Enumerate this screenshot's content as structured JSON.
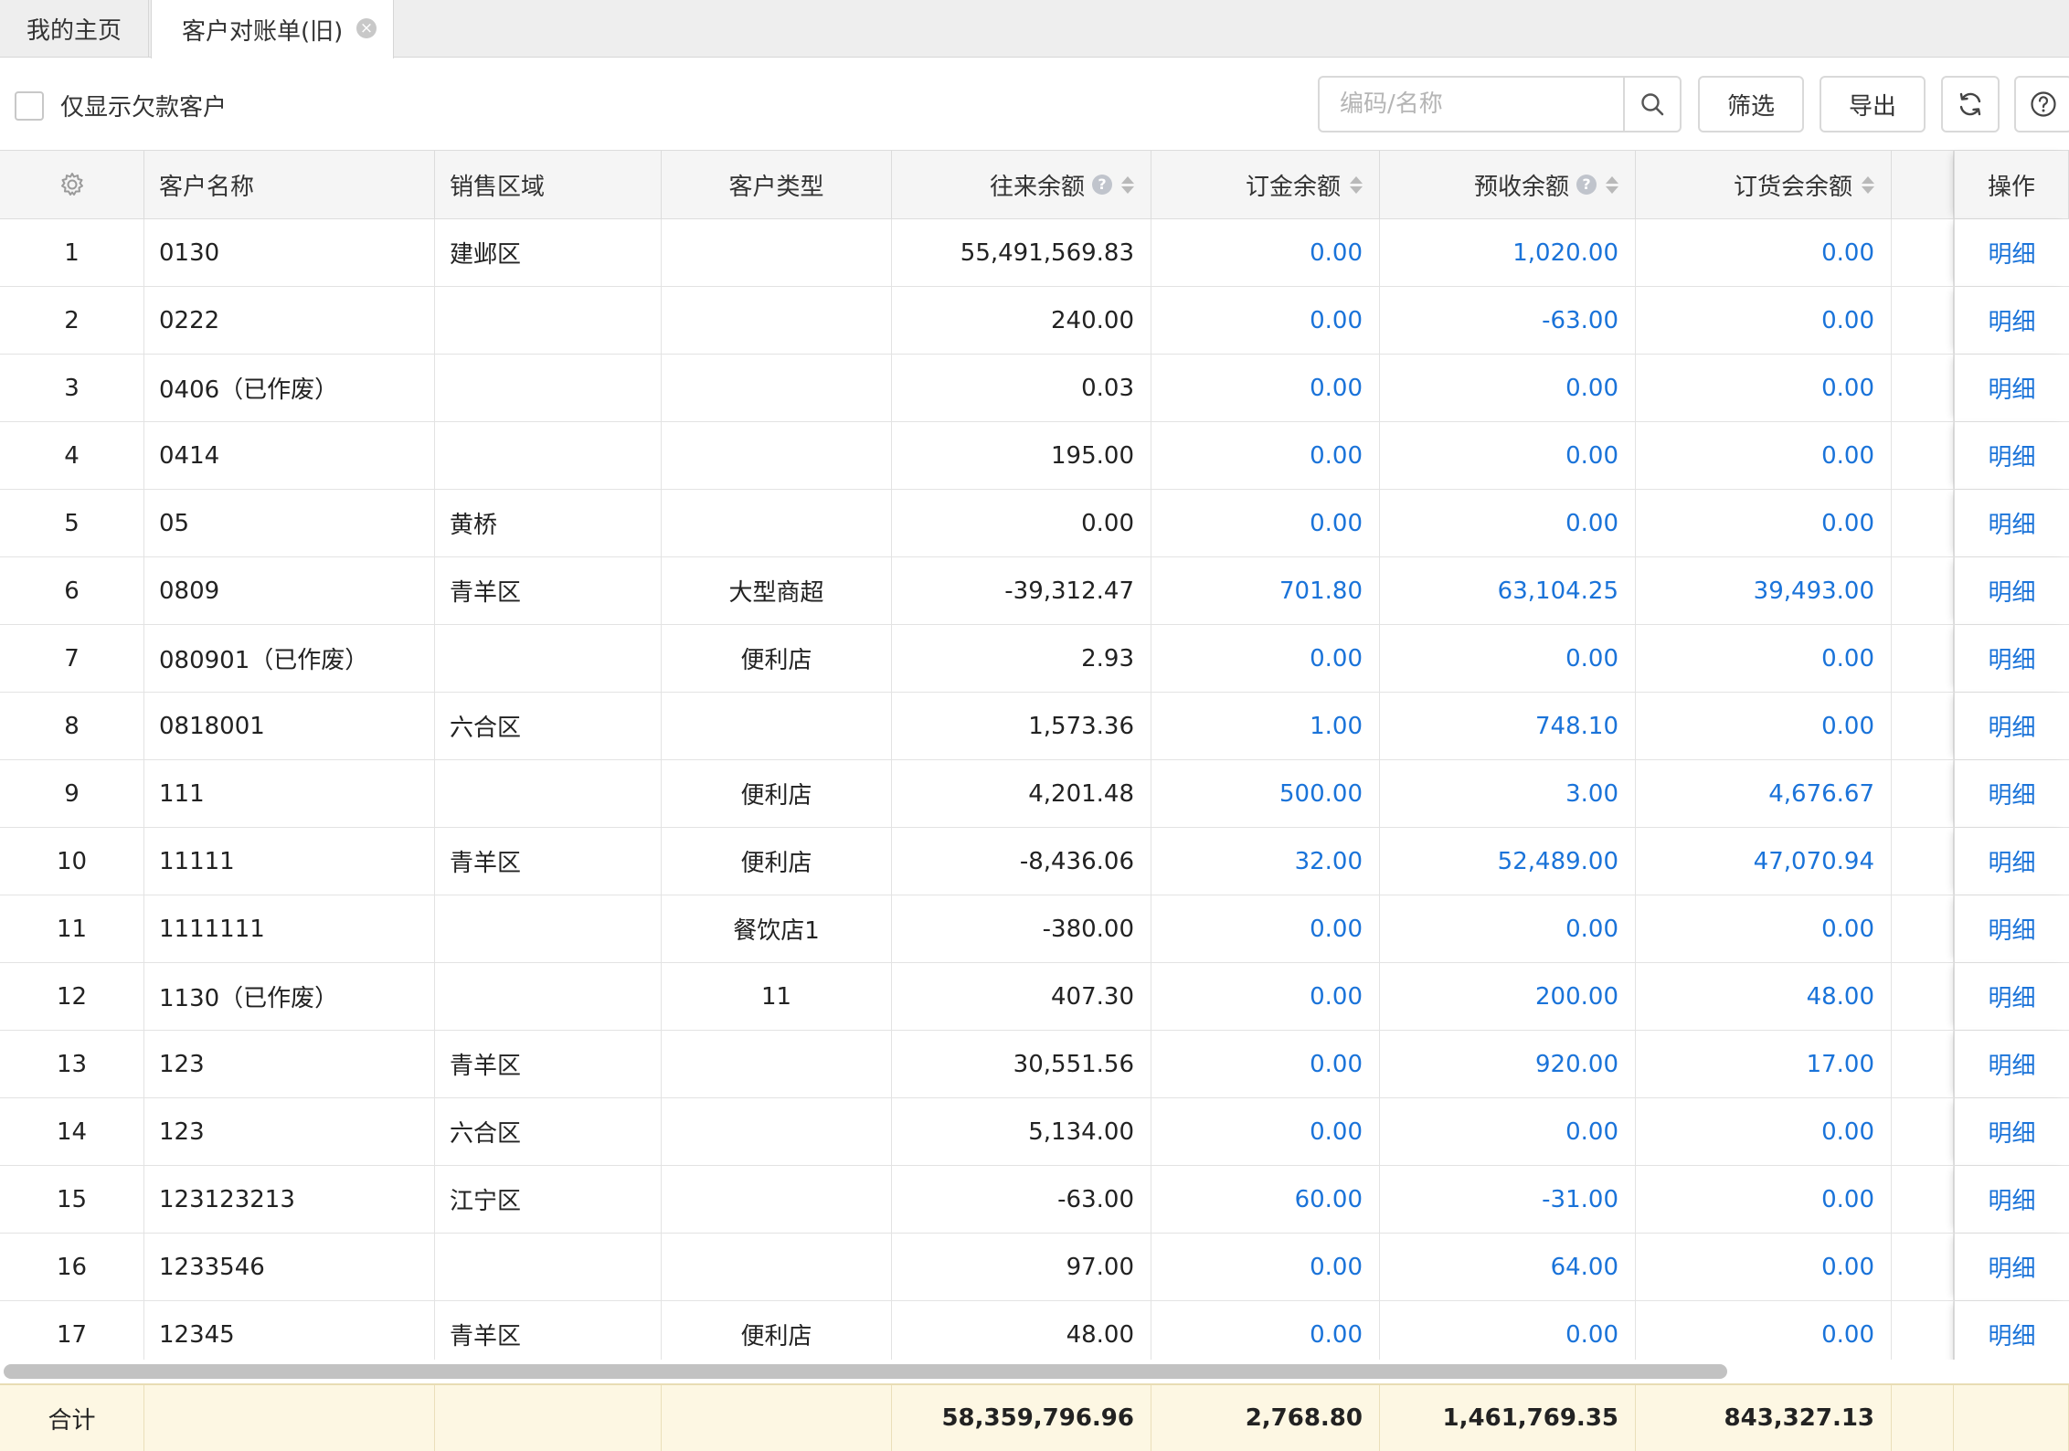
{
  "tabs": {
    "home": "我的主页",
    "active": "客户对账单(旧)",
    "close_glyph": "×"
  },
  "toolbar": {
    "only_debt_label": "仅显示欠款客户",
    "search_placeholder": "编码/名称",
    "filter_label": "筛选",
    "export_label": "导出"
  },
  "columns": {
    "name": "客户名称",
    "region": "销售区域",
    "type": "客户类型",
    "balance": "往来余额",
    "deposit": "订金余额",
    "prepaid": "预收余额",
    "order_meeting": "订货会余额",
    "operation": "操作"
  },
  "help_glyph": "?",
  "detail_label": "明细",
  "rows": [
    {
      "idx": "1",
      "name": "0130",
      "region": "建邺区",
      "type": "",
      "balance": "55,491,569.83",
      "deposit": "0.00",
      "prepaid": "1,020.00",
      "order_meeting": "0.00"
    },
    {
      "idx": "2",
      "name": "0222",
      "region": "",
      "type": "",
      "balance": "240.00",
      "deposit": "0.00",
      "prepaid": "-63.00",
      "order_meeting": "0.00"
    },
    {
      "idx": "3",
      "name": "0406（已作废）",
      "region": "",
      "type": "",
      "balance": "0.03",
      "deposit": "0.00",
      "prepaid": "0.00",
      "order_meeting": "0.00"
    },
    {
      "idx": "4",
      "name": "0414",
      "region": "",
      "type": "",
      "balance": "195.00",
      "deposit": "0.00",
      "prepaid": "0.00",
      "order_meeting": "0.00"
    },
    {
      "idx": "5",
      "name": "05",
      "region": "黄桥",
      "type": "",
      "balance": "0.00",
      "deposit": "0.00",
      "prepaid": "0.00",
      "order_meeting": "0.00"
    },
    {
      "idx": "6",
      "name": "0809",
      "region": "青羊区",
      "type": "大型商超",
      "balance": "-39,312.47",
      "deposit": "701.80",
      "prepaid": "63,104.25",
      "order_meeting": "39,493.00"
    },
    {
      "idx": "7",
      "name": "080901（已作废）",
      "region": "",
      "type": "便利店",
      "balance": "2.93",
      "deposit": "0.00",
      "prepaid": "0.00",
      "order_meeting": "0.00"
    },
    {
      "idx": "8",
      "name": "0818001",
      "region": "六合区",
      "type": "",
      "balance": "1,573.36",
      "deposit": "1.00",
      "prepaid": "748.10",
      "order_meeting": "0.00"
    },
    {
      "idx": "9",
      "name": "111",
      "region": "",
      "type": "便利店",
      "balance": "4,201.48",
      "deposit": "500.00",
      "prepaid": "3.00",
      "order_meeting": "4,676.67"
    },
    {
      "idx": "10",
      "name": "11111",
      "region": "青羊区",
      "type": "便利店",
      "balance": "-8,436.06",
      "deposit": "32.00",
      "prepaid": "52,489.00",
      "order_meeting": "47,070.94"
    },
    {
      "idx": "11",
      "name": "1111111",
      "region": "",
      "type": "餐饮店1",
      "balance": "-380.00",
      "deposit": "0.00",
      "prepaid": "0.00",
      "order_meeting": "0.00"
    },
    {
      "idx": "12",
      "name": "1130（已作废）",
      "region": "",
      "type": "11",
      "balance": "407.30",
      "deposit": "0.00",
      "prepaid": "200.00",
      "order_meeting": "48.00"
    },
    {
      "idx": "13",
      "name": "123",
      "region": "青羊区",
      "type": "",
      "balance": "30,551.56",
      "deposit": "0.00",
      "prepaid": "920.00",
      "order_meeting": "17.00"
    },
    {
      "idx": "14",
      "name": "123",
      "region": "六合区",
      "type": "",
      "balance": "5,134.00",
      "deposit": "0.00",
      "prepaid": "0.00",
      "order_meeting": "0.00"
    },
    {
      "idx": "15",
      "name": "123123213",
      "region": "江宁区",
      "type": "",
      "balance": "-63.00",
      "deposit": "60.00",
      "prepaid": "-31.00",
      "order_meeting": "0.00"
    },
    {
      "idx": "16",
      "name": "1233546",
      "region": "",
      "type": "",
      "balance": "97.00",
      "deposit": "0.00",
      "prepaid": "64.00",
      "order_meeting": "0.00"
    },
    {
      "idx": "17",
      "name": "12345",
      "region": "青羊区",
      "type": "便利店",
      "balance": "48.00",
      "deposit": "0.00",
      "prepaid": "0.00",
      "order_meeting": "0.00"
    }
  ],
  "totals": {
    "label": "合计",
    "balance": "58,359,796.96",
    "deposit": "2,768.80",
    "prepaid": "1,461,769.35",
    "order_meeting": "843,327.13"
  },
  "colors": {
    "link_blue": "#1a73d9",
    "footer_bg": "#fdf7e3"
  },
  "icons": {
    "settings": "gear-icon",
    "search": "search-icon",
    "refresh": "refresh-icon",
    "help": "help-circle-icon",
    "close": "close-icon"
  }
}
